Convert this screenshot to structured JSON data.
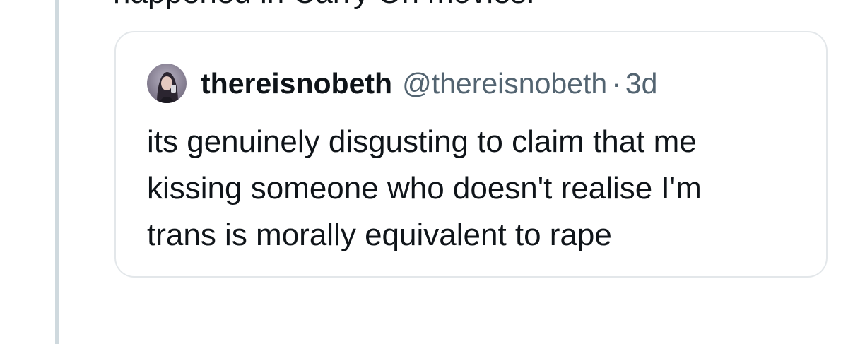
{
  "parent_tweet": {
    "text_fragment": "happened in Carry On movies."
  },
  "quoted_tweet": {
    "display_name": "thereisnobeth",
    "handle": "@thereisnobeth",
    "separator": "·",
    "timestamp": "3d",
    "avatar_icon": "user-avatar-photo",
    "body_lines": [
      "its genuinely disgusting to claim that me",
      "kissing someone who doesn't realise I'm",
      "trans is morally equivalent to rape"
    ]
  },
  "colors": {
    "text_primary": "#0f1419",
    "text_secondary": "#536471",
    "border": "#e3e7ea",
    "thread_line": "#cfd9de"
  }
}
